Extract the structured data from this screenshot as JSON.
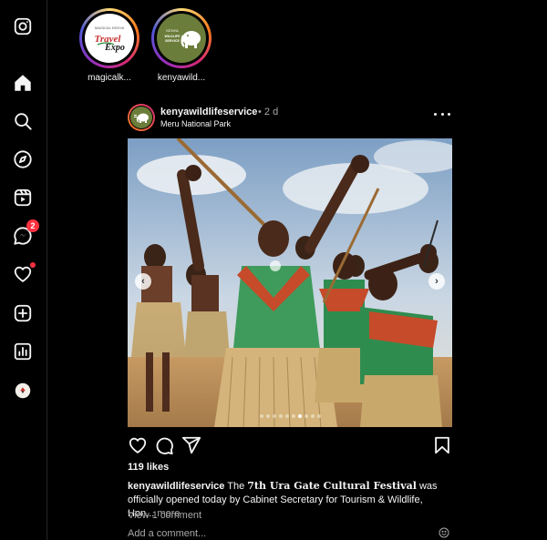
{
  "sidebar": {
    "items": [
      {
        "name": "instagram-logo-icon"
      },
      {
        "name": "home-icon"
      },
      {
        "name": "search-icon"
      },
      {
        "name": "explore-icon"
      },
      {
        "name": "reels-icon"
      },
      {
        "name": "messages-icon",
        "badge": "2"
      },
      {
        "name": "notifications-icon",
        "has_dot": true
      },
      {
        "name": "create-icon"
      },
      {
        "name": "dashboard-icon"
      },
      {
        "name": "profile-icon"
      }
    ]
  },
  "stories": [
    {
      "username": "magicalk...",
      "logo_top": "MAGICAL KENYA",
      "logo_main": "Travel",
      "logo_sub": "Expo"
    },
    {
      "username": "kenyawild...",
      "logo_top": "KENYA",
      "logo_main": "WILDLIFE",
      "logo_sub": "SERVICE"
    }
  ],
  "post": {
    "username": "kenyawildlifeservice",
    "time": "• 2 d",
    "location": "Meru National Park",
    "carousel": {
      "total": 10,
      "active": 6
    },
    "likes": "119 likes",
    "caption": {
      "username": "kenyawildlifeservice",
      "text_before": " The ",
      "highlight": "7th Ura Gate Cultural Festival",
      "text_after": " was officially opened today by Cabinet Secretary for Tourism & Wildlife, Hon...",
      "more": " more"
    },
    "view_comments": "View 1 comment",
    "add_comment_placeholder": "Add a comment..."
  },
  "colors": {
    "background": "#000000",
    "text": "#f5f5f5",
    "muted": "#a8a8a8",
    "badge": "#ff3040",
    "divider": "#262626"
  }
}
